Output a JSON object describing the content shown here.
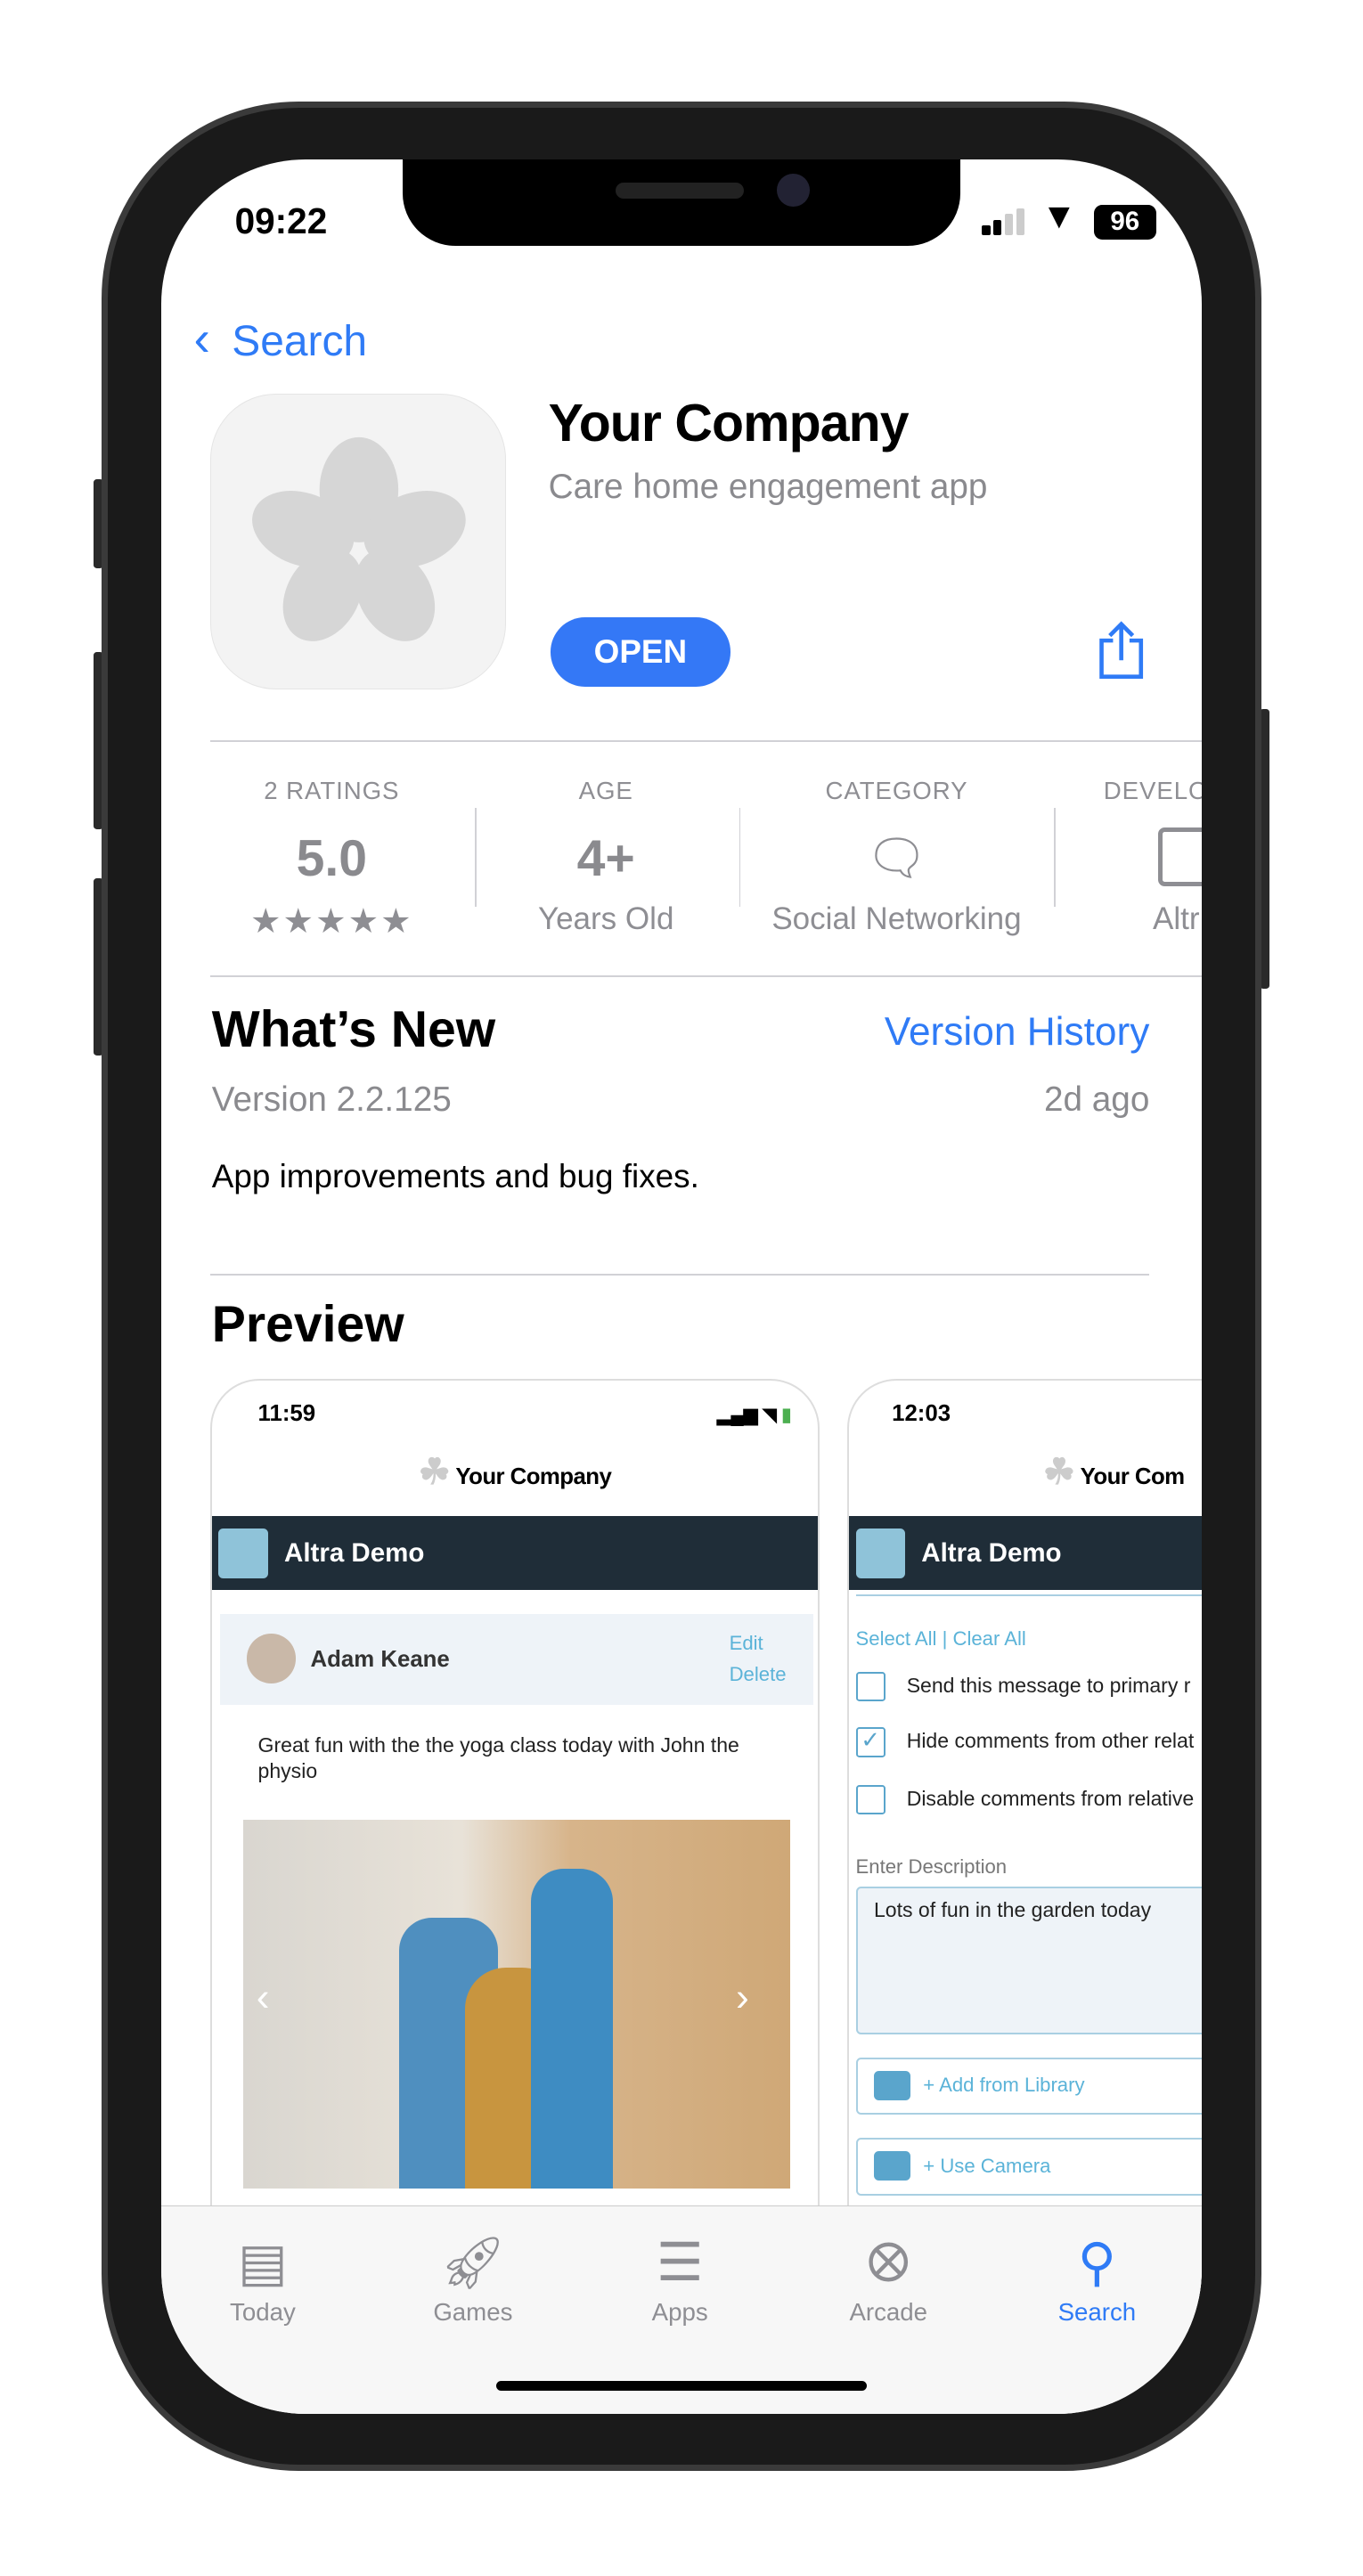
{
  "status_bar": {
    "time": "09:22",
    "battery": "96"
  },
  "nav": {
    "back_label": "Search"
  },
  "app": {
    "title": "Your Company",
    "subtitle": "Care home engagement app",
    "open_label": "OPEN"
  },
  "info": [
    {
      "label": "2 RATINGS",
      "value": "5.0",
      "sub": "★★★★★"
    },
    {
      "label": "AGE",
      "value": "4+",
      "sub": "Years Old"
    },
    {
      "label": "CATEGORY",
      "value": "",
      "sub": "Social Networking"
    },
    {
      "label": "DEVELO",
      "value": "",
      "sub": "Altr"
    }
  ],
  "whats_new": {
    "title": "What’s New",
    "version_history": "Version History",
    "version": "Version 2.2.125",
    "date": "2d ago",
    "notes": "App improvements and bug fixes."
  },
  "preview": {
    "title": "Preview",
    "screens": [
      {
        "time": "11:59",
        "brand": "Your Company",
        "org": "Altra Demo",
        "author": "Adam Keane",
        "edit": "Edit",
        "delete": "Delete",
        "post": "Great fun with the the yoga class today with John the physio"
      },
      {
        "time": "12:03",
        "brand": "Your Com",
        "org": "Altra Demo",
        "select": "Select All | Clear All",
        "options": [
          {
            "label": "Send this message to primary r",
            "checked": false
          },
          {
            "label": "Hide comments from other relat",
            "checked": true
          },
          {
            "label": "Disable comments from relative",
            "checked": false
          }
        ],
        "desc_label": "Enter Description",
        "desc_value": "Lots of fun in the garden today",
        "add_library": "+ Add from Library",
        "use_camera": "+ Use Camera"
      }
    ]
  },
  "tabs": [
    {
      "label": "Today",
      "icon": "today-icon",
      "active": false
    },
    {
      "label": "Games",
      "icon": "rocket-icon",
      "active": false
    },
    {
      "label": "Apps",
      "icon": "layers-icon",
      "active": false
    },
    {
      "label": "Arcade",
      "icon": "joystick-icon",
      "active": false
    },
    {
      "label": "Search",
      "icon": "search-icon",
      "active": true
    }
  ],
  "colors": {
    "accent": "#3478f6",
    "dark_bar": "#1f2d38",
    "link_light": "#5bb3d8"
  }
}
